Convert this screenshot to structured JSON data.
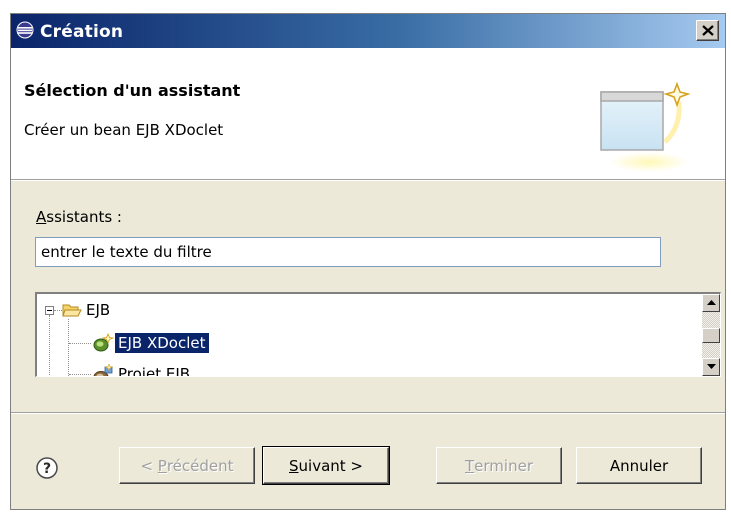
{
  "window": {
    "title": "Création",
    "close_glyph": "✕"
  },
  "header": {
    "title": "Sélection d'un assistant",
    "description": "Créer un bean EJB XDoclet",
    "image_icon": "wizard-banner-icon"
  },
  "assistants": {
    "label_mnemonic": "A",
    "label_rest": "ssistants :",
    "filter_value": "entrer le texte du filtre"
  },
  "tree": {
    "folder": {
      "label": "EJB",
      "icon": "folder-open-icon",
      "expanded": true
    },
    "items": [
      {
        "label": "EJB XDoclet",
        "icon": "ejb-bean-icon",
        "selected": true
      },
      {
        "label": "Projet EJB",
        "icon": "ejb-project-icon",
        "selected": false
      }
    ]
  },
  "buttons": {
    "help_icon": "help-icon",
    "prev_prefix": "< ",
    "prev_mnemonic": "P",
    "prev_rest": "récédent",
    "next_mnemonic": "S",
    "next_rest": "uivant >",
    "finish_mnemonic": "T",
    "finish_rest": "erminer",
    "cancel": "Annuler"
  },
  "colors": {
    "titlebar_start": "#0a246a",
    "titlebar_end": "#a6caf0",
    "selection": "#0a246a",
    "dialog_bg": "#ece9d8"
  }
}
